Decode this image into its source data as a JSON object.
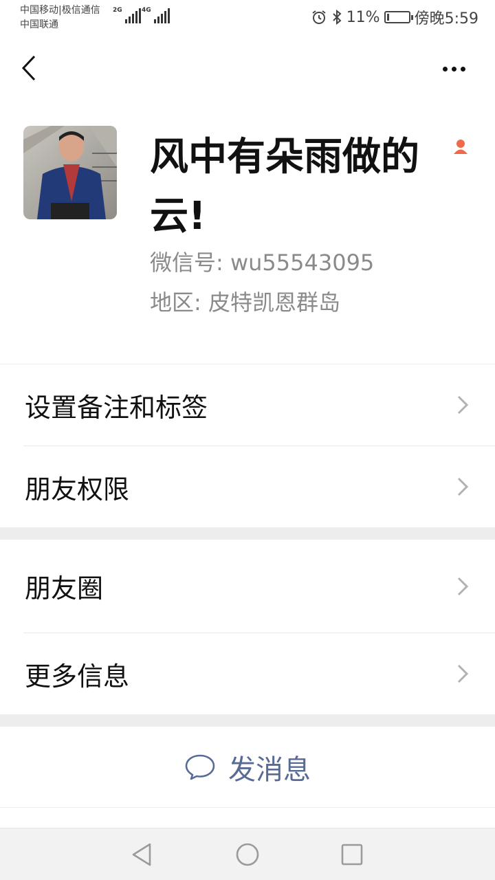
{
  "status_bar": {
    "carrier_line1": "中国移动|极信通信",
    "carrier_line2": "中国联通",
    "signal1_gen": "2G",
    "signal2_gen": "4G",
    "battery_percent": "11%",
    "battery_level": 0.11,
    "time": "傍晚5:59"
  },
  "nav": {
    "back_icon": "back-chevron-icon",
    "more_icon": "more-dots-icon"
  },
  "profile": {
    "name": "风中有朵雨做的云!",
    "wechat_id": "微信号: wu55543095",
    "region": "地区: 皮特凯恩群岛",
    "gender_icon": "female-person-icon",
    "gender_color": "#f06a4a"
  },
  "menu_group1": [
    {
      "label": "设置备注和标签"
    },
    {
      "label": "朋友权限"
    }
  ],
  "menu_group2": [
    {
      "label": "朋友圈"
    },
    {
      "label": "更多信息"
    }
  ],
  "action": {
    "send_message": "发消息",
    "link_color": "#576b95"
  },
  "system_nav": {
    "back": "triangle-back-icon",
    "home": "circle-home-icon",
    "recents": "square-recents-icon"
  }
}
